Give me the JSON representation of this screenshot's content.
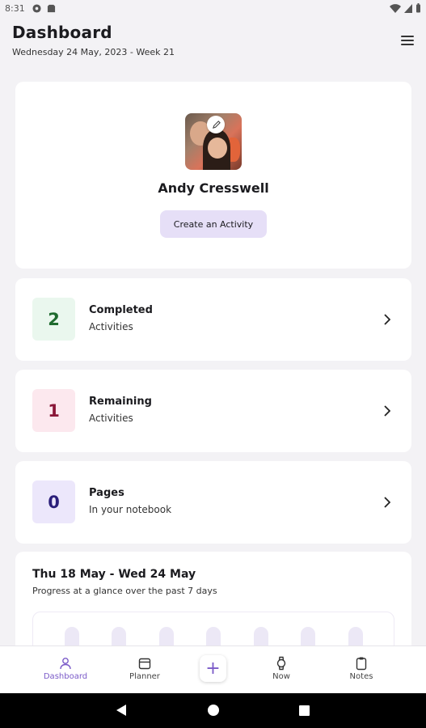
{
  "status_bar": {
    "time": "8:31"
  },
  "header": {
    "title": "Dashboard",
    "subtitle": "Wednesday 24 May, 2023 - Week 21"
  },
  "profile": {
    "name": "Andy Cresswell",
    "create_button": "Create an Activity"
  },
  "stats": [
    {
      "value": "2",
      "title": "Completed",
      "subtitle": "Activities",
      "box_bg": "#eaf7ee",
      "value_color": "#1f6b2f"
    },
    {
      "value": "1",
      "title": "Remaining",
      "subtitle": "Activities",
      "box_bg": "#fce8ee",
      "value_color": "#8a1738"
    },
    {
      "value": "0",
      "title": "Pages",
      "subtitle": "In your notebook",
      "box_bg": "#ece7fb",
      "value_color": "#2b1f7a"
    }
  ],
  "progress": {
    "title": "Thu 18 May - Wed 24 May",
    "subtitle": "Progress at a glance over the past 7 days"
  },
  "bottom_nav": [
    {
      "label": "Dashboard",
      "icon": "person-icon",
      "active": true
    },
    {
      "label": "Planner",
      "icon": "calendar-icon",
      "active": false
    },
    {
      "label": "Now",
      "icon": "watch-icon",
      "active": false
    },
    {
      "label": "Notes",
      "icon": "clipboard-icon",
      "active": false
    }
  ],
  "colors": {
    "accent": "#7a5ac8",
    "button_bg": "#e6dff7",
    "page_bg": "#f3f2f5"
  }
}
